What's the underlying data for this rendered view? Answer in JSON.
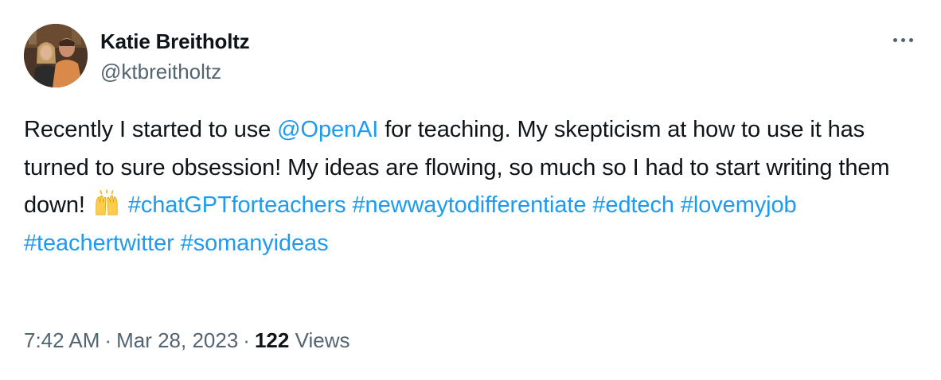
{
  "author": {
    "display_name": "Katie Breitholtz",
    "handle": "@ktbreitholtz"
  },
  "more_menu": {
    "icon": "more-horizontal-icon"
  },
  "tweet": {
    "part1": "Recently I started to use ",
    "mention": "@OpenAI",
    "part2": " for teaching. My skepticism at how to use it has turned to sure obsession! My ideas are flowing, so much so I had to start writing them down! ",
    "emoji_icon": "raising-hands-emoji",
    "hashtags": [
      "#chatGPTforteachers",
      "#newwaytodifferentiate",
      "#edtech",
      "#lovemyjob",
      "#teachertwitter",
      "#somanyideas"
    ]
  },
  "meta": {
    "time": "7:42 AM",
    "date": "Mar 28, 2023",
    "separator": "·",
    "view_count": "122",
    "views_label": "Views"
  },
  "colors": {
    "link": "#1d9bf0",
    "secondary_text": "#536471",
    "primary_text": "#0f1419"
  }
}
